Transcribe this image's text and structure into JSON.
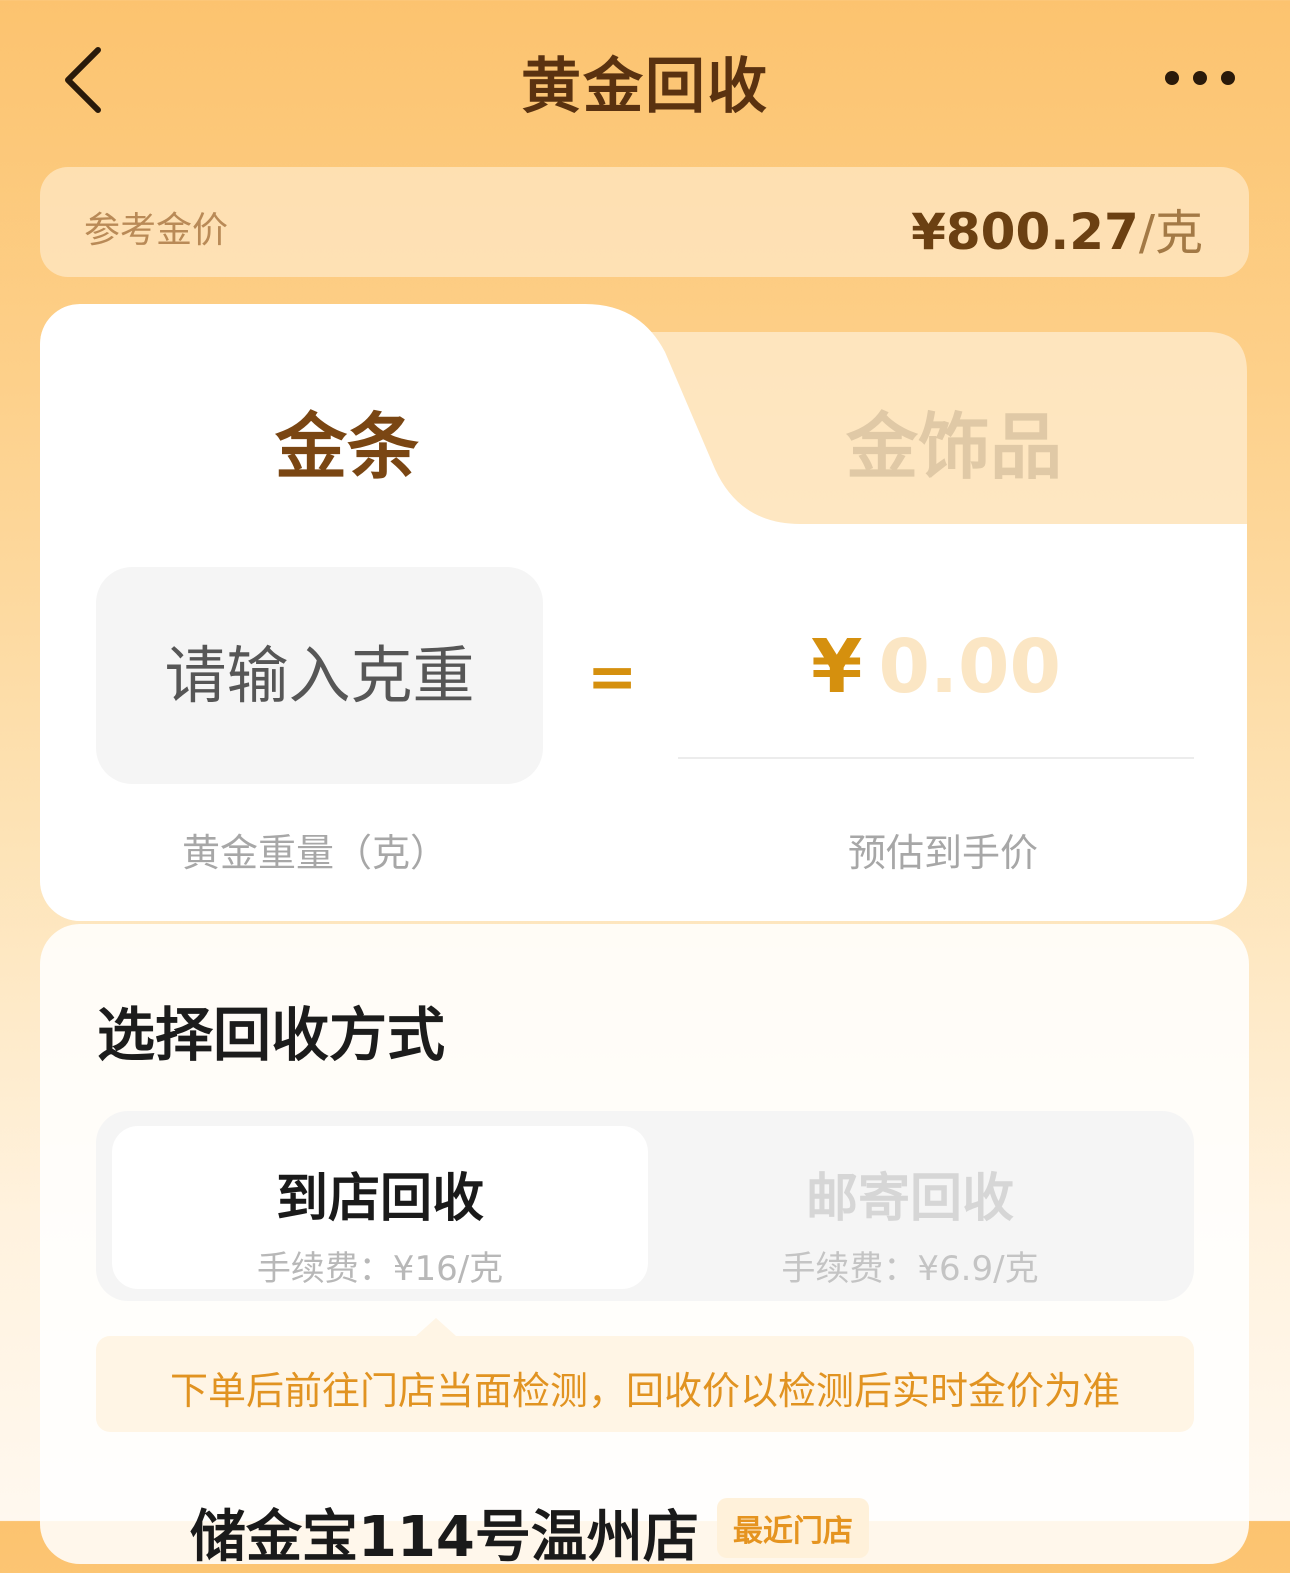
{
  "header": {
    "title": "黄金回收",
    "back_icon": "chevron-left-icon",
    "more_icon": "more-horizontal-icon"
  },
  "reference": {
    "label": "参考金价",
    "price": "¥800.27",
    "unit": "/克"
  },
  "tabs": [
    {
      "label": "金条",
      "active": true
    },
    {
      "label": "金饰品",
      "active": false
    }
  ],
  "calculator": {
    "weight_placeholder": "请输入克重",
    "weight_value": "",
    "equals": "=",
    "currency": "¥",
    "estimated_price": "0.00",
    "weight_label": "黄金重量（克）",
    "price_label": "预估到手价"
  },
  "recycle": {
    "title": "选择回收方式",
    "methods": [
      {
        "name": "到店回收",
        "fee": "手续费：¥16/克",
        "selected": true
      },
      {
        "name": "邮寄回收",
        "fee": "手续费：¥6.9/克",
        "selected": false
      }
    ],
    "tip": "下单后前往门店当面检测，回收价以检测后实时金价为准"
  },
  "store": {
    "name": "储金宝114号温州店",
    "badge": "最近门店"
  },
  "colors": {
    "accent": "#d5900e",
    "title_brown": "#5a3210",
    "tip_orange": "#e19321"
  }
}
